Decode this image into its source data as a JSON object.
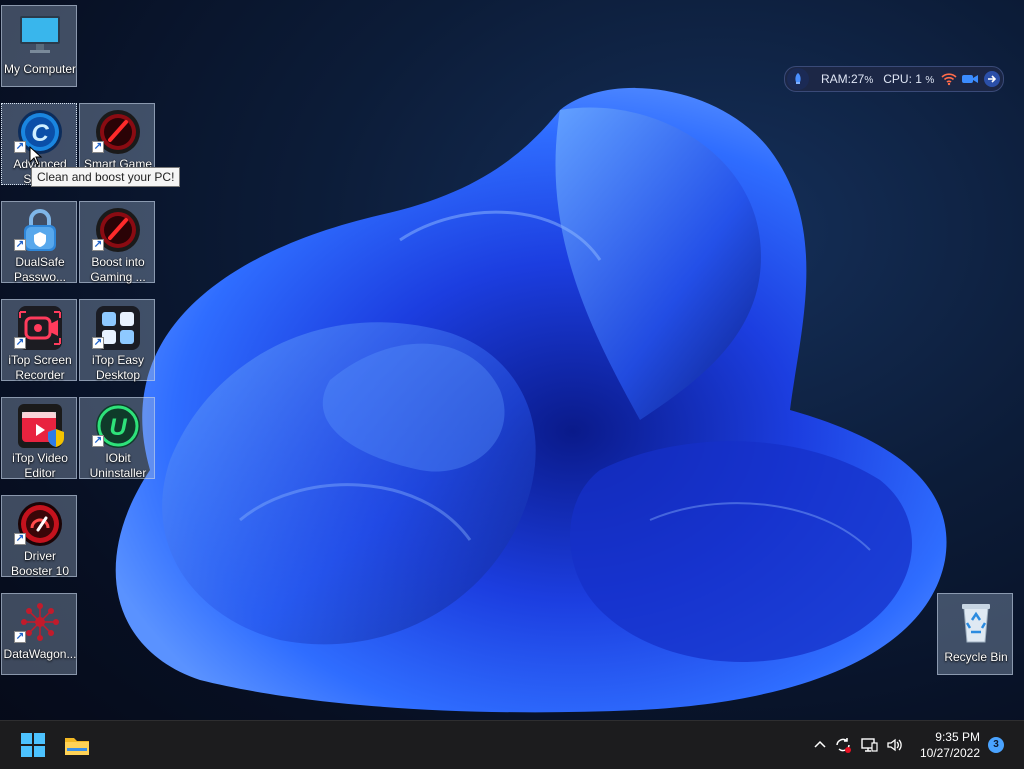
{
  "desktop": {
    "icons": [
      {
        "label": "My Computer"
      },
      {
        "label": "Advanced Syst..."
      },
      {
        "label": "Smart Game"
      },
      {
        "label": "DualSafe Passwo..."
      },
      {
        "label": "Boost into Gaming ..."
      },
      {
        "label": "iTop Screen Recorder"
      },
      {
        "label": "iTop Easy Desktop"
      },
      {
        "label": "iTop Video Editor"
      },
      {
        "label": "IObit Uninstaller"
      },
      {
        "label": "Driver Booster 10"
      },
      {
        "label": "DataWagon..."
      },
      {
        "label": "Recycle Bin"
      }
    ],
    "tooltip": "Clean and boost your PC!"
  },
  "monitor": {
    "ram_label": "RAM:",
    "ram_value": "27",
    "cpu_label": "CPU:",
    "cpu_value": "1",
    "unit": "%"
  },
  "taskbar": {
    "time": "9:35 PM",
    "date": "10/27/2022",
    "notification_count": "3"
  },
  "icons_semantic": [
    "windows-start-icon",
    "file-explorer-icon",
    "chevron-up-icon",
    "sync-icon",
    "network-icon",
    "volume-icon"
  ],
  "colors": {
    "accent": "#1f62c9",
    "taskbar": "#1c1c1e",
    "notif": "#4aa3ff"
  }
}
